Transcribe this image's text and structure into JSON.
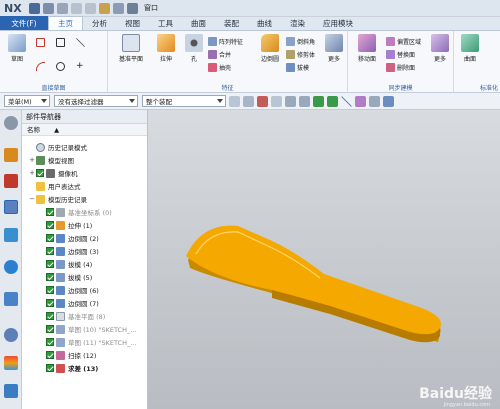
{
  "app": {
    "logo": "NX",
    "window_label": "窗口"
  },
  "menu": {
    "file": "文件(F)",
    "tabs": [
      "主页",
      "分析",
      "视图",
      "工具",
      "曲面",
      "装配",
      "曲线",
      "渲染",
      "应用模块"
    ]
  },
  "ribbon": {
    "sketch": "草图",
    "group_direct_sketch": "直接草图",
    "datum_plane": "基准平面",
    "extrude": "拉伸",
    "hole": "孔",
    "array_feature": "阵列特征",
    "combine": "合并",
    "shell": "抽壳",
    "edge_blend": "边倒圆",
    "chamfer": "倒斜角",
    "trim_body": "修剪体",
    "draft": "拔模",
    "more": "更多",
    "group_feature": "特征",
    "move_face": "移动面",
    "offset_region": "偏置区域",
    "replace_face": "替换面",
    "delete_face": "删除面",
    "group_sync": "同步建模",
    "surface": "曲面",
    "group_standard": "标准化"
  },
  "cmdbar": {
    "menu": "菜单(M)",
    "filter": "没有选择过滤器",
    "scope": "整个装配"
  },
  "navigator": {
    "title": "部件导航器",
    "col_name": "名称",
    "items": [
      {
        "label": "历史记录模式"
      },
      {
        "label": "模型视图"
      },
      {
        "label": "摄像机"
      },
      {
        "label": "用户表达式"
      },
      {
        "label": "模型历史记录"
      },
      {
        "label": "基准坐标系 (0)"
      },
      {
        "label": "拉伸 (1)"
      },
      {
        "label": "边倒圆 (2)"
      },
      {
        "label": "边倒圆 (3)"
      },
      {
        "label": "拔模 (4)"
      },
      {
        "label": "拔模 (5)"
      },
      {
        "label": "边倒圆 (6)"
      },
      {
        "label": "边倒圆 (7)"
      },
      {
        "label": "基准平面 (8)"
      },
      {
        "label": "草图 (10) \"SKETCH_..."
      },
      {
        "label": "草图 (11) \"SKETCH_..."
      },
      {
        "label": "扫掠 (12)"
      },
      {
        "label": "求差 (13)"
      }
    ]
  },
  "watermark": {
    "text": "Baidu经验",
    "sub": "jingyan.baidu.com"
  },
  "colors": {
    "part": "#f5a800",
    "accent": "#2b65b1",
    "check": "#2e9b3a"
  }
}
